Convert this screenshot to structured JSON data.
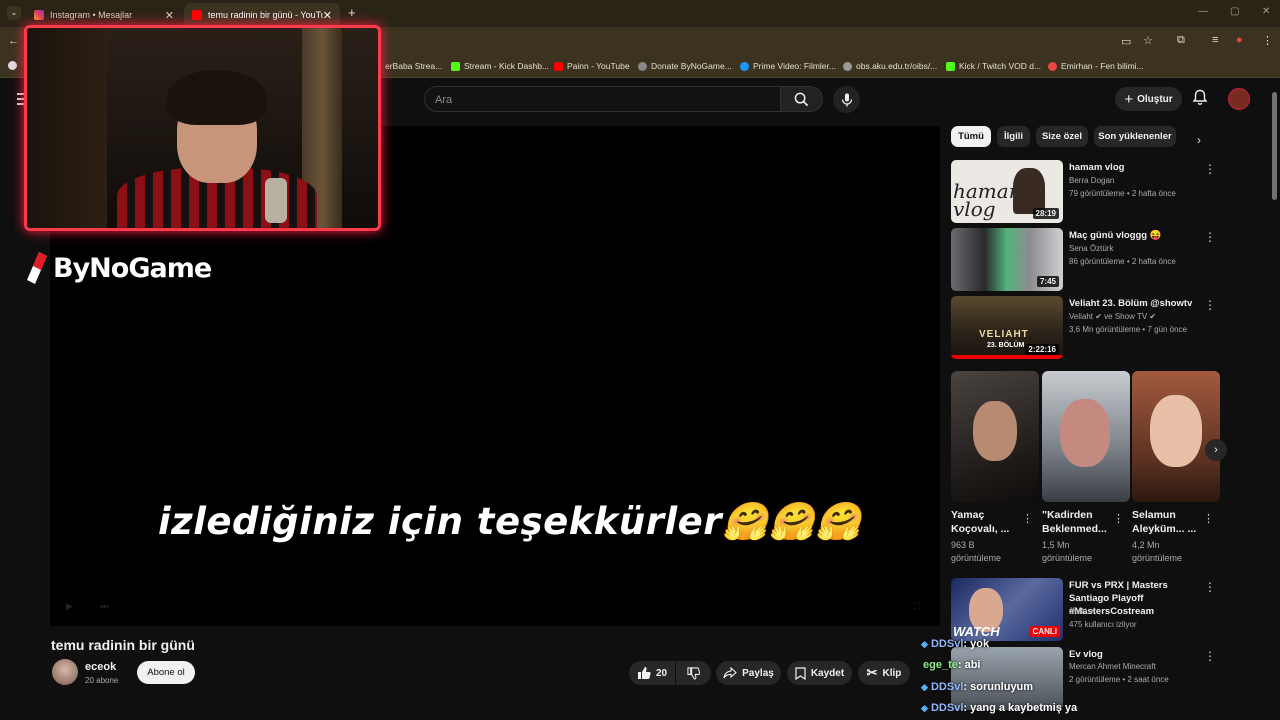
{
  "browser": {
    "tabs": [
      {
        "label": "Instagram • Mesajlar",
        "active": false
      },
      {
        "label": "temu radinin bir günü - YouTube",
        "active": true
      }
    ],
    "bookmarks": [
      "erBaba Strea...",
      "Stream - Kick Dashb...",
      "Painn - YouTube",
      "Donate ByNoGame...",
      "Prime Video: Filmler...",
      "obs.aku.edu.tr/oibs/...",
      "Kick / Twitch VOD d...",
      "Emirhan - Fen bilimi..."
    ]
  },
  "header": {
    "search_placeholder": "Ara",
    "create_label": "Oluştur"
  },
  "overlay": {
    "logo_text": "ByNoGame"
  },
  "player": {
    "subtitle": "izlediğiniz için teşekkürler🤗🤗🤗"
  },
  "video": {
    "title": "temu radinin bir günü",
    "channel": "eceok",
    "subscribers": "20 abone",
    "subscribe_label": "Abone ol",
    "like_count": "20",
    "share_label": "Paylaş",
    "save_label": "Kaydet",
    "clip_label": "Klip"
  },
  "chips": [
    "Tümü",
    "İlgili",
    "Size özel",
    "Son yüklenenler"
  ],
  "recommendations": [
    {
      "title": "hamam vlog",
      "channel": "Berra Dogan",
      "meta": "79 görüntüleme • 2 hafta önce",
      "duration": "28:19"
    },
    {
      "title": "Maç günü vloggg 😝",
      "channel": "Sena Öztürk",
      "meta": "86 görüntüleme • 2 hafta önce",
      "duration": "7:45"
    },
    {
      "title": "Veliaht 23. Bölüm @showtv",
      "channel": "Veliaht ✔ ve Show TV ✔",
      "meta": "3,6 Mn görüntüleme • 7 gün önce",
      "duration": "2:22:16"
    }
  ],
  "shorts": [
    {
      "title": "Yamaç Koçovalı, ...",
      "views": "963 B görüntüleme"
    },
    {
      "title": "\"Kadirden Beklenmed...",
      "views": "1,5 Mn görüntüleme"
    },
    {
      "title": "Selamun Aleyküm... ...",
      "views": "4,2 Mn görüntüleme"
    }
  ],
  "more_recommendations": [
    {
      "title": "FUR vs PRX | Masters Santiago Playoff #MastersCostream",
      "channel": "wtcN ✔",
      "meta": "475 kullanıcı izliyor",
      "badge": "CANLI"
    },
    {
      "title": "Ev vlog",
      "channel": "Mercan Ahmet Minecraft",
      "meta": "2 görüntüleme • 2 saat önce"
    }
  ],
  "chat": [
    {
      "user": "DDSvl",
      "text": ": yok"
    },
    {
      "user": "ege_te",
      "text": ": abi"
    },
    {
      "user": "DDSvl",
      "text": ": sorunluyum"
    },
    {
      "user": "DDSvl",
      "text": ": yang a kaybetmiş ya"
    }
  ]
}
